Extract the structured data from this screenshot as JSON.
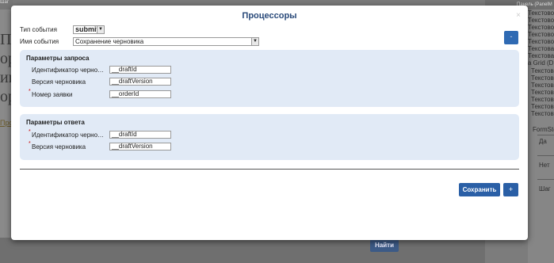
{
  "background": {
    "left_strip_text": "Шаг",
    "left_big_chars": [
      "Пр",
      "ор",
      "ин",
      "ор"
    ],
    "left_link": "Про",
    "find_button": "Найти",
    "right_header": "Панель (PanelM",
    "right_rows": [
      "Текстовое п",
      "Текстовое п",
      "Текстовое п",
      "Текстовое п",
      "Текстовое п",
      "Текстовая м",
      "Текстовая м",
      "Текстовое п",
      "a Grid (D",
      "Текстово",
      "Текстово",
      "Текстово",
      "Текстово",
      "Текстово",
      "Текстово",
      "Текстово"
    ],
    "right_col_header": "FormSte",
    "right_cells": [
      "Да",
      "Нет",
      "Шаг"
    ]
  },
  "modal": {
    "title": "Процессоры",
    "close": "×",
    "event_type_label": "Тип события",
    "event_type_value": "submit",
    "event_name_label": "Имя события",
    "event_name_value": "Сохранение черновика",
    "minus_button": "-",
    "request_panel": {
      "title": "Параметры запроса",
      "fields": [
        {
          "label": "Идентификатор черно…",
          "value": "__draftId",
          "required": false
        },
        {
          "label": "Версия черновика",
          "value": "__draftVersion",
          "required": false
        },
        {
          "label": "Номер заявки",
          "value": "__orderId",
          "required": true
        }
      ]
    },
    "response_panel": {
      "title": "Параметры ответа",
      "fields": [
        {
          "label": "Идентификатор черно…",
          "value": "__draftId",
          "required": true
        },
        {
          "label": "Версия черновика",
          "value": "__draftVersion",
          "required": true
        }
      ]
    },
    "save_button": "Сохранить",
    "plus_button": "+",
    "dropdown_arrow": "▼",
    "required_mark": "*"
  }
}
